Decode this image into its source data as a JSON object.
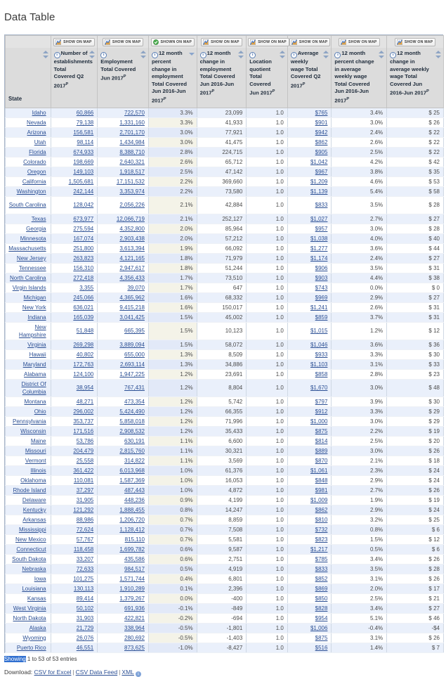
{
  "page": {
    "title": "Data Table"
  },
  "map_buttons": [
    {
      "label": "SHOW ON MAP",
      "state": "off"
    },
    {
      "label": "SHOW ON MAP",
      "state": "off"
    },
    {
      "label": "SHOWN ON MAP",
      "state": "on"
    },
    {
      "label": "SHOW ON MAP",
      "state": "off"
    },
    {
      "label": "SHOW ON MAP",
      "state": "off"
    },
    {
      "label": "SHOW ON MAP",
      "state": "off"
    },
    {
      "label": "SHOW ON MAP",
      "state": "off"
    },
    {
      "label": "SHOW ON MAP",
      "state": "off"
    }
  ],
  "columns": [
    {
      "label": "State",
      "sort": "none",
      "info": false
    },
    {
      "label": "Number of establishments Total Covered Q2 2017",
      "sup": "P",
      "sort": "both",
      "info": true
    },
    {
      "label": "Employment Total Covered Jun 2017",
      "sup": "P",
      "sort": "both",
      "info": true
    },
    {
      "label": "12 month percent change in employment Total Covered Jun 2016-Jun 2017",
      "sup": "P",
      "sort": "desc",
      "info": true
    },
    {
      "label": "12 month change in employment Total Covered Jun 2016-Jun 2017",
      "sup": "P",
      "sort": "both",
      "info": true
    },
    {
      "label": "Location quotient Total Covered Jun 2017",
      "sup": "P",
      "sort": "both",
      "info": true
    },
    {
      "label": "Average weekly wage Total Covered Q2 2017",
      "sup": "P",
      "sort": "both",
      "info": true
    },
    {
      "label": "12 month percent change in average weekly wage Total Covered Jun 2016-Jun 2017",
      "sup": "P",
      "sort": "both",
      "info": true
    },
    {
      "label": "12 month change in average weekly wage Total Covered Jun 2016-Jun 2017",
      "sup": "P",
      "sort": "both",
      "info": true
    }
  ],
  "rows": [
    {
      "state": "Idaho",
      "establishments": "60,866",
      "employment": "722,570",
      "emp_pct": "3.3%",
      "emp_chg": "23,099",
      "lq": "1.0",
      "wage": "$765",
      "wage_pct": "3.4%",
      "wage_chg": "$ 25"
    },
    {
      "state": "Nevada",
      "establishments": "79,138",
      "employment": "1,331,160",
      "emp_pct": "3.3%",
      "emp_chg": "41,933",
      "lq": "1.0",
      "wage": "$901",
      "wage_pct": "3.0%",
      "wage_chg": "$ 26"
    },
    {
      "state": "Arizona",
      "establishments": "156,581",
      "employment": "2,701,170",
      "emp_pct": "3.0%",
      "emp_chg": "77,921",
      "lq": "1.0",
      "wage": "$942",
      "wage_pct": "2.4%",
      "wage_chg": "$ 22"
    },
    {
      "state": "Utah",
      "establishments": "98,114",
      "employment": "1,434,984",
      "emp_pct": "3.0%",
      "emp_chg": "41,475",
      "lq": "1.0",
      "wage": "$862",
      "wage_pct": "2.6%",
      "wage_chg": "$ 22"
    },
    {
      "state": "Florida",
      "establishments": "674,933",
      "employment": "8,388,710",
      "emp_pct": "2.8%",
      "emp_chg": "224,715",
      "lq": "1.0",
      "wage": "$905",
      "wage_pct": "2.5%",
      "wage_chg": "$ 22"
    },
    {
      "state": "Colorado",
      "establishments": "198,669",
      "employment": "2,640,321",
      "emp_pct": "2.6%",
      "emp_chg": "65,712",
      "lq": "1.0",
      "wage": "$1,042",
      "wage_pct": "4.2%",
      "wage_chg": "$ 42"
    },
    {
      "state": "Oregon",
      "establishments": "149,103",
      "employment": "1,918,517",
      "emp_pct": "2.5%",
      "emp_chg": "47,142",
      "lq": "1.0",
      "wage": "$967",
      "wage_pct": "3.8%",
      "wage_chg": "$ 35"
    },
    {
      "state": "California",
      "establishments": "1,505,681",
      "employment": "17,151,532",
      "emp_pct": "2.2%",
      "emp_chg": "369,660",
      "lq": "1.0",
      "wage": "$1,209",
      "wage_pct": "4.6%",
      "wage_chg": "$ 53"
    },
    {
      "state": "Washington",
      "establishments": "242,144",
      "employment": "3,353,974",
      "emp_pct": "2.2%",
      "emp_chg": "73,580",
      "lq": "1.0",
      "wage": "$1,139",
      "wage_pct": "5.4%",
      "wage_chg": "$ 58"
    },
    {
      "state": "South Carolina",
      "establishments": "128,042",
      "employment": "2,056,226",
      "emp_pct": "2.1%",
      "emp_chg": "42,884",
      "lq": "1.0",
      "wage": "$833",
      "wage_pct": "3.5%",
      "wage_chg": "$ 28",
      "tall": true
    },
    {
      "state": "Texas",
      "establishments": "673,977",
      "employment": "12,066,719",
      "emp_pct": "2.1%",
      "emp_chg": "252,127",
      "lq": "1.0",
      "wage": "$1,027",
      "wage_pct": "2.7%",
      "wage_chg": "$ 27"
    },
    {
      "state": "Georgia",
      "establishments": "275,594",
      "employment": "4,352,800",
      "emp_pct": "2.0%",
      "emp_chg": "85,964",
      "lq": "1.0",
      "wage": "$957",
      "wage_pct": "3.0%",
      "wage_chg": "$ 28"
    },
    {
      "state": "Minnesota",
      "establishments": "167,074",
      "employment": "2,903,438",
      "emp_pct": "2.0%",
      "emp_chg": "57,212",
      "lq": "1.0",
      "wage": "$1,038",
      "wage_pct": "4.0%",
      "wage_chg": "$ 40"
    },
    {
      "state": "Massachusetts",
      "establishments": "251,800",
      "employment": "3,613,394",
      "emp_pct": "1.9%",
      "emp_chg": "66,092",
      "lq": "1.0",
      "wage": "$1,277",
      "wage_pct": "3.6%",
      "wage_chg": "$ 44"
    },
    {
      "state": "New Jersey",
      "establishments": "263,823",
      "employment": "4,121,165",
      "emp_pct": "1.8%",
      "emp_chg": "71,979",
      "lq": "1.0",
      "wage": "$1,174",
      "wage_pct": "2.4%",
      "wage_chg": "$ 27"
    },
    {
      "state": "Tennessee",
      "establishments": "156,310",
      "employment": "2,947,617",
      "emp_pct": "1.8%",
      "emp_chg": "51,244",
      "lq": "1.0",
      "wage": "$906",
      "wage_pct": "3.5%",
      "wage_chg": "$ 31"
    },
    {
      "state": "North Carolina",
      "establishments": "272,418",
      "employment": "4,356,433",
      "emp_pct": "1.7%",
      "emp_chg": "73,510",
      "lq": "1.0",
      "wage": "$903",
      "wage_pct": "4.4%",
      "wage_chg": "$ 38"
    },
    {
      "state": "Virgin Islands",
      "establishments": "3,355",
      "employment": "39,070",
      "emp_pct": "1.7%",
      "emp_chg": "647",
      "lq": "1.0",
      "wage": "$743",
      "wage_pct": "0.0%",
      "wage_chg": "$ 0"
    },
    {
      "state": "Michigan",
      "establishments": "245,066",
      "employment": "4,365,962",
      "emp_pct": "1.6%",
      "emp_chg": "68,332",
      "lq": "1.0",
      "wage": "$969",
      "wage_pct": "2.9%",
      "wage_chg": "$ 27"
    },
    {
      "state": "New York",
      "establishments": "636,021",
      "employment": "9,415,218",
      "emp_pct": "1.6%",
      "emp_chg": "150,017",
      "lq": "1.0",
      "wage": "$1,241",
      "wage_pct": "2.6%",
      "wage_chg": "$ 31"
    },
    {
      "state": "Indiana",
      "establishments": "165,039",
      "employment": "3,041,425",
      "emp_pct": "1.5%",
      "emp_chg": "45,002",
      "lq": "1.0",
      "wage": "$859",
      "wage_pct": "3.7%",
      "wage_chg": "$ 31"
    },
    {
      "state": "New Hampshire",
      "establishments": "51,848",
      "employment": "665,395",
      "emp_pct": "1.5%",
      "emp_chg": "10,123",
      "lq": "1.0",
      "wage": "$1,015",
      "wage_pct": "1.2%",
      "wage_chg": "$ 12",
      "tall": true
    },
    {
      "state": "Virginia",
      "establishments": "269,298",
      "employment": "3,889,094",
      "emp_pct": "1.5%",
      "emp_chg": "58,072",
      "lq": "1.0",
      "wage": "$1,046",
      "wage_pct": "3.6%",
      "wage_chg": "$ 36"
    },
    {
      "state": "Hawaii",
      "establishments": "40,802",
      "employment": "655,000",
      "emp_pct": "1.3%",
      "emp_chg": "8,509",
      "lq": "1.0",
      "wage": "$933",
      "wage_pct": "3.3%",
      "wage_chg": "$ 30"
    },
    {
      "state": "Maryland",
      "establishments": "172,763",
      "employment": "2,693,114",
      "emp_pct": "1.3%",
      "emp_chg": "34,886",
      "lq": "1.0",
      "wage": "$1,103",
      "wage_pct": "3.1%",
      "wage_chg": "$ 33"
    },
    {
      "state": "Alabama",
      "establishments": "124,100",
      "employment": "1,947,225",
      "emp_pct": "1.2%",
      "emp_chg": "23,691",
      "lq": "1.0",
      "wage": "$858",
      "wage_pct": "2.8%",
      "wage_chg": "$ 23"
    },
    {
      "state": "District Of Columbia",
      "establishments": "38,954",
      "employment": "767,431",
      "emp_pct": "1.2%",
      "emp_chg": "8,804",
      "lq": "1.0",
      "wage": "$1,670",
      "wage_pct": "3.0%",
      "wage_chg": "$ 48",
      "tall": true
    },
    {
      "state": "Montana",
      "establishments": "48,271",
      "employment": "473,354",
      "emp_pct": "1.2%",
      "emp_chg": "5,742",
      "lq": "1.0",
      "wage": "$797",
      "wage_pct": "3.9%",
      "wage_chg": "$ 30"
    },
    {
      "state": "Ohio",
      "establishments": "296,002",
      "employment": "5,424,490",
      "emp_pct": "1.2%",
      "emp_chg": "66,355",
      "lq": "1.0",
      "wage": "$912",
      "wage_pct": "3.3%",
      "wage_chg": "$ 29"
    },
    {
      "state": "Pennsylvania",
      "establishments": "353,737",
      "employment": "5,858,018",
      "emp_pct": "1.2%",
      "emp_chg": "71,996",
      "lq": "1.0",
      "wage": "$1,000",
      "wage_pct": "3.0%",
      "wage_chg": "$ 29"
    },
    {
      "state": "Wisconsin",
      "establishments": "171,516",
      "employment": "2,908,532",
      "emp_pct": "1.2%",
      "emp_chg": "35,433",
      "lq": "1.0",
      "wage": "$875",
      "wage_pct": "2.2%",
      "wage_chg": "$ 19"
    },
    {
      "state": "Maine",
      "establishments": "53,786",
      "employment": "630,191",
      "emp_pct": "1.1%",
      "emp_chg": "6,600",
      "lq": "1.0",
      "wage": "$814",
      "wage_pct": "2.5%",
      "wage_chg": "$ 20"
    },
    {
      "state": "Missouri",
      "establishments": "204,479",
      "employment": "2,815,760",
      "emp_pct": "1.1%",
      "emp_chg": "30,321",
      "lq": "1.0",
      "wage": "$889",
      "wage_pct": "3.0%",
      "wage_chg": "$ 26"
    },
    {
      "state": "Vermont",
      "establishments": "25,558",
      "employment": "314,822",
      "emp_pct": "1.1%",
      "emp_chg": "3,569",
      "lq": "1.0",
      "wage": "$870",
      "wage_pct": "2.1%",
      "wage_chg": "$ 18"
    },
    {
      "state": "Illinois",
      "establishments": "361,422",
      "employment": "6,013,968",
      "emp_pct": "1.0%",
      "emp_chg": "61,376",
      "lq": "1.0",
      "wage": "$1,061",
      "wage_pct": "2.3%",
      "wage_chg": "$ 24"
    },
    {
      "state": "Oklahoma",
      "establishments": "110,081",
      "employment": "1,587,369",
      "emp_pct": "1.0%",
      "emp_chg": "16,053",
      "lq": "1.0",
      "wage": "$848",
      "wage_pct": "2.9%",
      "wage_chg": "$ 24"
    },
    {
      "state": "Rhode Island",
      "establishments": "37,297",
      "employment": "487,443",
      "emp_pct": "1.0%",
      "emp_chg": "4,872",
      "lq": "1.0",
      "wage": "$981",
      "wage_pct": "2.7%",
      "wage_chg": "$ 26"
    },
    {
      "state": "Delaware",
      "establishments": "31,905",
      "employment": "448,236",
      "emp_pct": "0.9%",
      "emp_chg": "4,199",
      "lq": "1.0",
      "wage": "$1,009",
      "wage_pct": "1.9%",
      "wage_chg": "$ 19"
    },
    {
      "state": "Kentucky",
      "establishments": "121,292",
      "employment": "1,888,455",
      "emp_pct": "0.8%",
      "emp_chg": "14,247",
      "lq": "1.0",
      "wage": "$862",
      "wage_pct": "2.9%",
      "wage_chg": "$ 24"
    },
    {
      "state": "Arkansas",
      "establishments": "88,986",
      "employment": "1,206,720",
      "emp_pct": "0.7%",
      "emp_chg": "8,859",
      "lq": "1.0",
      "wage": "$810",
      "wage_pct": "3.2%",
      "wage_chg": "$ 25"
    },
    {
      "state": "Mississippi",
      "establishments": "72,624",
      "employment": "1,128,412",
      "emp_pct": "0.7%",
      "emp_chg": "7,508",
      "lq": "1.0",
      "wage": "$732",
      "wage_pct": "0.8%",
      "wage_chg": "$ 6"
    },
    {
      "state": "New Mexico",
      "establishments": "57,767",
      "employment": "815,110",
      "emp_pct": "0.7%",
      "emp_chg": "5,581",
      "lq": "1.0",
      "wage": "$823",
      "wage_pct": "1.5%",
      "wage_chg": "$ 12"
    },
    {
      "state": "Connecticut",
      "establishments": "118,458",
      "employment": "1,699,782",
      "emp_pct": "0.6%",
      "emp_chg": "9,587",
      "lq": "1.0",
      "wage": "$1,217",
      "wage_pct": "0.5%",
      "wage_chg": "$ 6"
    },
    {
      "state": "South Dakota",
      "establishments": "33,207",
      "employment": "435,586",
      "emp_pct": "0.6%",
      "emp_chg": "2,751",
      "lq": "1.0",
      "wage": "$785",
      "wage_pct": "3.4%",
      "wage_chg": "$ 26"
    },
    {
      "state": "Nebraska",
      "establishments": "72,633",
      "employment": "984,517",
      "emp_pct": "0.5%",
      "emp_chg": "4,919",
      "lq": "1.0",
      "wage": "$833",
      "wage_pct": "3.5%",
      "wage_chg": "$ 28"
    },
    {
      "state": "Iowa",
      "establishments": "101,275",
      "employment": "1,571,744",
      "emp_pct": "0.4%",
      "emp_chg": "6,801",
      "lq": "1.0",
      "wage": "$852",
      "wage_pct": "3.1%",
      "wage_chg": "$ 26"
    },
    {
      "state": "Louisiana",
      "establishments": "130,113",
      "employment": "1,910,289",
      "emp_pct": "0.1%",
      "emp_chg": "2,396",
      "lq": "1.0",
      "wage": "$869",
      "wage_pct": "2.0%",
      "wage_chg": "$ 17"
    },
    {
      "state": "Kansas",
      "establishments": "89,414",
      "employment": "1,379,267",
      "emp_pct": "0.0%",
      "emp_chg": "-400",
      "lq": "1.0",
      "wage": "$850",
      "wage_pct": "2.5%",
      "wage_chg": "$ 21"
    },
    {
      "state": "West Virginia",
      "establishments": "50,102",
      "employment": "691,936",
      "emp_pct": "-0.1%",
      "emp_chg": "-849",
      "lq": "1.0",
      "wage": "$828",
      "wage_pct": "3.4%",
      "wage_chg": "$ 27"
    },
    {
      "state": "North Dakota",
      "establishments": "31,903",
      "employment": "422,821",
      "emp_pct": "-0.2%",
      "emp_chg": "-694",
      "lq": "1.0",
      "wage": "$954",
      "wage_pct": "5.1%",
      "wage_chg": "$ 46"
    },
    {
      "state": "Alaska",
      "establishments": "21,729",
      "employment": "338,964",
      "emp_pct": "-0.5%",
      "emp_chg": "-1,801",
      "lq": "1.0",
      "wage": "$1,006",
      "wage_pct": "-0.4%",
      "wage_chg": "-$4"
    },
    {
      "state": "Wyoming",
      "establishments": "26,076",
      "employment": "280,692",
      "emp_pct": "-0.5%",
      "emp_chg": "-1,403",
      "lq": "1.0",
      "wage": "$875",
      "wage_pct": "3.1%",
      "wage_chg": "$ 26"
    },
    {
      "state": "Puerto Rico",
      "establishments": "46,551",
      "employment": "873,625",
      "emp_pct": "-1.0%",
      "emp_chg": "-8,427",
      "lq": "1.0",
      "wage": "$516",
      "wage_pct": "1.4%",
      "wage_chg": "$ 7"
    }
  ],
  "footer": {
    "showing_highlight": "Showing",
    "showing_rest": " 1 to 53 of 53 entries",
    "download_label": "Download:",
    "links": [
      {
        "label": "CSV for Excel"
      },
      {
        "label": "CSV Data Feed"
      },
      {
        "label": "XML"
      }
    ],
    "separator": "|"
  },
  "colors": {
    "header_bg": "#dcdcdc",
    "sorted_odd": "#f4f3e8",
    "row_even": "#eaf0fb",
    "link": "#2b4f94",
    "highlight": "#2f6fd0",
    "map_on": "#4caf50"
  }
}
